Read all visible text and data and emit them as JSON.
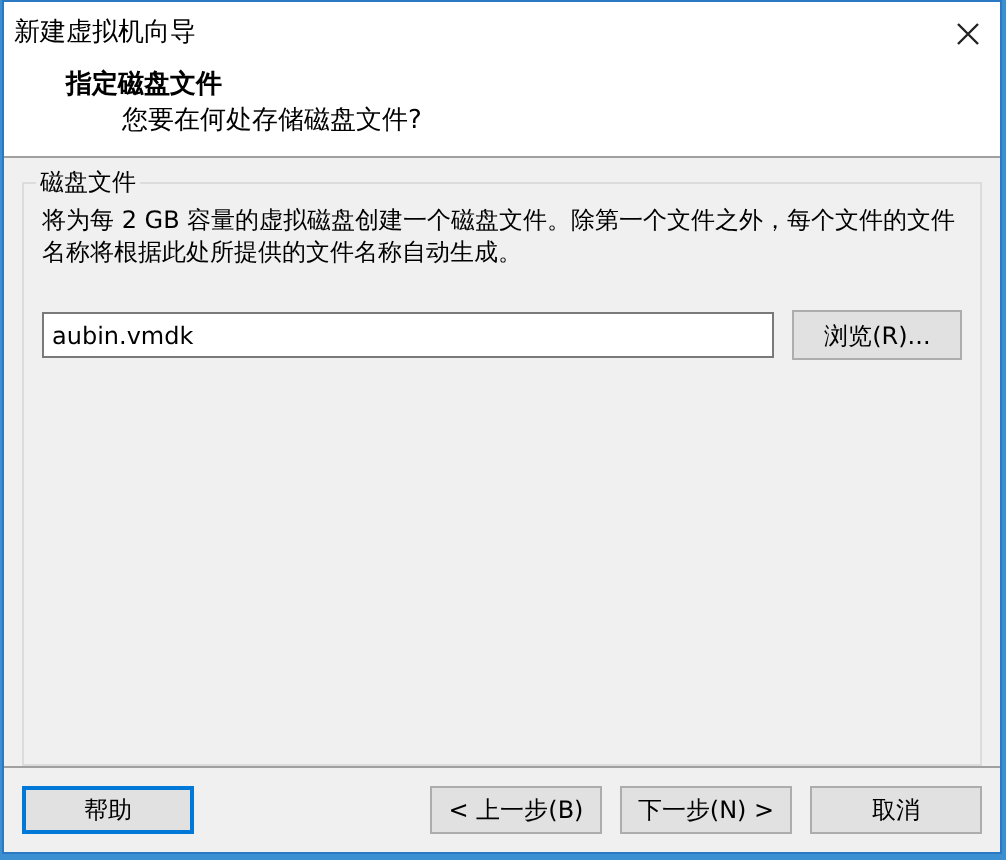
{
  "window": {
    "title": "新建虚拟机向导"
  },
  "header": {
    "title": "指定磁盘文件",
    "subtitle": "您要在何处存储磁盘文件?"
  },
  "group": {
    "label": "磁盘文件",
    "description": "将为每 2 GB 容量的虚拟磁盘创建一个磁盘文件。除第一个文件之外，每个文件的文件名称将根据此处所提供的文件名称自动生成。",
    "file_name": "aubin.vmdk",
    "browse_button": "浏览(R)..."
  },
  "buttons": [
    {
      "label": "帮助",
      "focused": true
    },
    {
      "label": "< 上一步(B)",
      "focused": false
    },
    {
      "label": "下一步(N) >",
      "focused": false
    },
    {
      "label": "取消",
      "focused": false
    }
  ]
}
